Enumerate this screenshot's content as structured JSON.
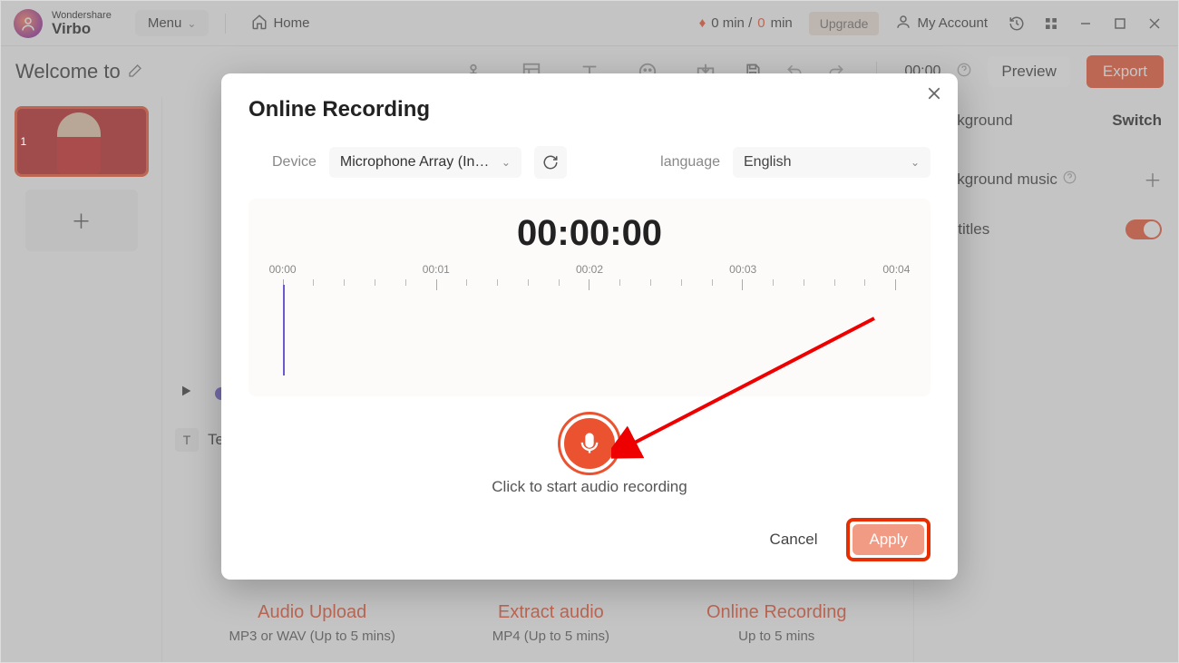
{
  "brand": {
    "top": "Wondershare",
    "bottom": "Virbo"
  },
  "titlebar": {
    "menu": "Menu",
    "home": "Home",
    "credits_prefix": "0 min / ",
    "credits_zero": "0",
    "credits_suffix": " min",
    "upgrade": "Upgrade",
    "account": "My Account"
  },
  "toolbar": {
    "welcome": "Welcome to",
    "time": "00:00",
    "preview": "Preview",
    "export": "Export"
  },
  "slides": {
    "num1": "1"
  },
  "text_row_label": "Tex",
  "text_chip": "T",
  "rightpanel": {
    "background": "Background",
    "switch": "Switch",
    "bgmusic": "Background music",
    "subtitles": "Subtitles"
  },
  "cards": {
    "audio_upload_t": "Audio Upload",
    "audio_upload_s": "MP3 or WAV (Up to 5 mins)",
    "extract_t": "Extract audio",
    "extract_s": "MP4 (Up to 5 mins)",
    "online_t": "Online Recording",
    "online_s": "Up to 5 mins"
  },
  "modal": {
    "title": "Online Recording",
    "device_label": "Device",
    "device_value": "Microphone Array (In…",
    "language_label": "language",
    "language_value": "English",
    "timer": "00:00:00",
    "ticks": [
      "00:00",
      "00:01",
      "00:02",
      "00:03",
      "00:04"
    ],
    "hint": "Click to start audio recording",
    "cancel": "Cancel",
    "apply": "Apply"
  }
}
